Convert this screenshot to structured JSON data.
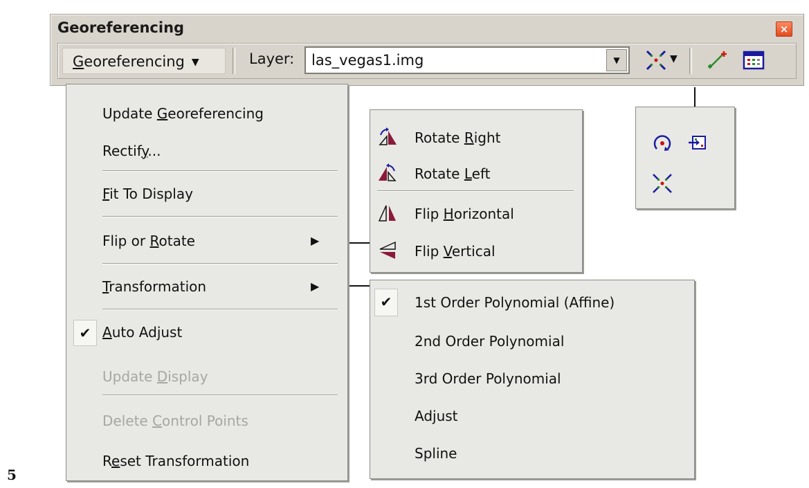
{
  "window": {
    "title": "Georeferencing",
    "close_icon": "close-icon"
  },
  "toolbar": {
    "menu_button": {
      "prefix": "G",
      "rest": "eoreferencing",
      "arrow": "▼"
    },
    "layer_label": "Layer:",
    "layer_value": "las_vegas1.img",
    "layer_drop_arrow": "▼",
    "tool_drop_arrow": "▼",
    "icons": [
      "full-extent-icon",
      "add-control-points-icon",
      "view-link-table-icon"
    ]
  },
  "main_menu": {
    "items": [
      {
        "pre": "Update ",
        "u": "G",
        "post": "eoreferencing",
        "enabled": true
      },
      {
        "pre": "Rectif",
        "u": "y",
        "post": "...",
        "enabled": true
      },
      {
        "pre": "",
        "u": "F",
        "post": "it To Display",
        "enabled": true
      },
      {
        "pre": "Flip or ",
        "u": "R",
        "post": "otate",
        "enabled": true,
        "submenu_arrow": "▶"
      },
      {
        "pre": "",
        "u": "T",
        "post": "ransformation",
        "enabled": true,
        "submenu_arrow": "▶"
      },
      {
        "pre": "",
        "u": "A",
        "post": "uto Adjust",
        "enabled": true,
        "checked": true,
        "check": "✔"
      },
      {
        "pre": "Update ",
        "u": "D",
        "post": "isplay",
        "enabled": false
      },
      {
        "pre": "Delete ",
        "u": "C",
        "post": "ontrol Points",
        "enabled": false
      },
      {
        "pre": "R",
        "u": "e",
        "post": "set Transformation",
        "enabled": true
      }
    ]
  },
  "flip_menu": {
    "items": [
      {
        "pre": "Rotate ",
        "u": "R",
        "post": "ight",
        "icon": "rotate-right-icon"
      },
      {
        "pre": "Rotate ",
        "u": "L",
        "post": "eft",
        "icon": "rotate-left-icon"
      },
      {
        "pre": "Flip ",
        "u": "H",
        "post": "orizontal",
        "icon": "flip-horizontal-icon"
      },
      {
        "pre": "Flip ",
        "u": "V",
        "post": "ertical",
        "icon": "flip-vertical-icon"
      }
    ]
  },
  "trans_menu": {
    "items": [
      {
        "label": "1st Order Polynomial (Affine)",
        "checked": true,
        "check": "✔"
      },
      {
        "label": "2nd Order Polynomial"
      },
      {
        "label": "3rd Order Polynomial"
      },
      {
        "label": "Adjust"
      },
      {
        "label": "Spline"
      }
    ]
  },
  "tool_palette": {
    "icons": [
      "rotate-icon",
      "shift-icon",
      "scale-icon"
    ]
  },
  "page_number": "5"
}
